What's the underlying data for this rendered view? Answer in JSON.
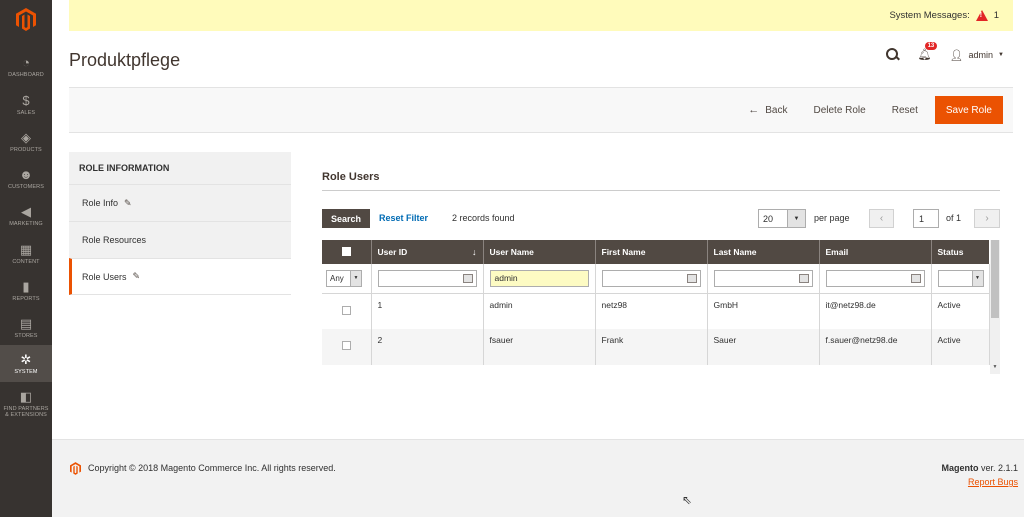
{
  "sidebar": {
    "items": [
      {
        "label": "Dashboard",
        "icon": "dashboard-icon",
        "glyph": "◔"
      },
      {
        "label": "Sales",
        "icon": "dollar-icon",
        "glyph": "$"
      },
      {
        "label": "Products",
        "icon": "cube-icon",
        "glyph": "◈"
      },
      {
        "label": "Customers",
        "icon": "person-icon",
        "glyph": "☻"
      },
      {
        "label": "Marketing",
        "icon": "megaphone-icon",
        "glyph": "◀"
      },
      {
        "label": "Content",
        "icon": "layout-icon",
        "glyph": "▦"
      },
      {
        "label": "Reports",
        "icon": "bar-chart-icon",
        "glyph": "▮"
      },
      {
        "label": "Stores",
        "icon": "store-icon",
        "glyph": "▤"
      },
      {
        "label": "System",
        "icon": "gear-icon",
        "glyph": "✲"
      },
      {
        "label1": "Find Partners",
        "label2": "& Extensions",
        "icon": "box-icon",
        "glyph": "◧"
      }
    ]
  },
  "system_messages": {
    "label": "System Messages:",
    "count": "1"
  },
  "header": {
    "title": "Produktpflege",
    "notifications": "13",
    "user": "admin"
  },
  "actions": {
    "back": "Back",
    "delete": "Delete Role",
    "reset": "Reset",
    "save": "Save Role"
  },
  "tabs": {
    "title": "Role Information",
    "items": [
      "Role Info",
      "Role Resources",
      "Role Users"
    ]
  },
  "grid": {
    "title": "Role Users",
    "search": "Search",
    "reset_filter": "Reset Filter",
    "records": "2 records found",
    "per_page_value": "20",
    "per_page_label": "per page",
    "page": "1",
    "of": "of 1",
    "columns": [
      "User ID",
      "User Name",
      "First Name",
      "Last Name",
      "Email",
      "Status"
    ],
    "filter": {
      "any": "Any",
      "user_name": "admin"
    },
    "rows": [
      {
        "id": "1",
        "username": "admin",
        "first": "netz98",
        "last": "GmbH",
        "email": "it@netz98.de",
        "status": "Active"
      },
      {
        "id": "2",
        "username": "fsauer",
        "first": "Frank",
        "last": "Sauer",
        "email": "f.sauer@netz98.de",
        "status": "Active"
      }
    ]
  },
  "footer": {
    "copyright": "Copyright © 2018 Magento Commerce Inc. All rights reserved.",
    "brand": "Magento",
    "version": " ver. 2.1.1",
    "report_bugs": "Report Bugs"
  },
  "colors": {
    "accent": "#eb5202",
    "sidebar": "#373330",
    "grid_header": "#514943"
  }
}
